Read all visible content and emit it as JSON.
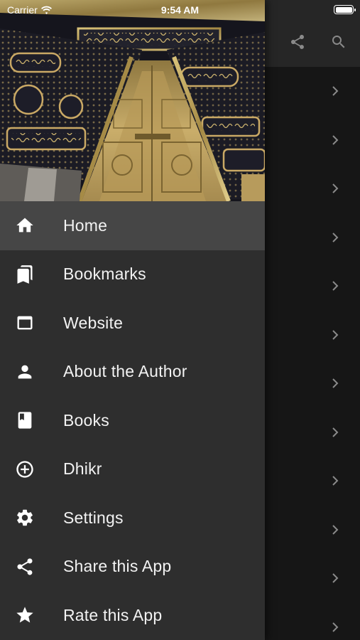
{
  "status_bar": {
    "carrier": "Carrier",
    "time": "9:54 AM"
  },
  "background_screen": {
    "appbar_actions": [
      "share-icon",
      "search-icon"
    ],
    "list_rows_visible": 12
  },
  "drawer": {
    "header_image": "kaaba-door-kiswah",
    "selected_index": 0,
    "items": [
      {
        "label": "Home",
        "icon": "home-icon"
      },
      {
        "label": "Bookmarks",
        "icon": "bookmarks-icon"
      },
      {
        "label": "Website",
        "icon": "website-icon"
      },
      {
        "label": "About the Author",
        "icon": "person-icon"
      },
      {
        "label": "Books",
        "icon": "book-icon"
      },
      {
        "label": "Dhikr",
        "icon": "add-circle-icon"
      },
      {
        "label": "Settings",
        "icon": "gear-icon"
      },
      {
        "label": "Share this App",
        "icon": "share-icon"
      },
      {
        "label": "Rate this App",
        "icon": "star-icon"
      }
    ]
  },
  "colors": {
    "drawer_bg": "#2e2e2e",
    "active_item_bg": "#464646",
    "appbar_bg": "#262626",
    "screen_bg": "#161616",
    "chevron": "#8a8a8a"
  }
}
